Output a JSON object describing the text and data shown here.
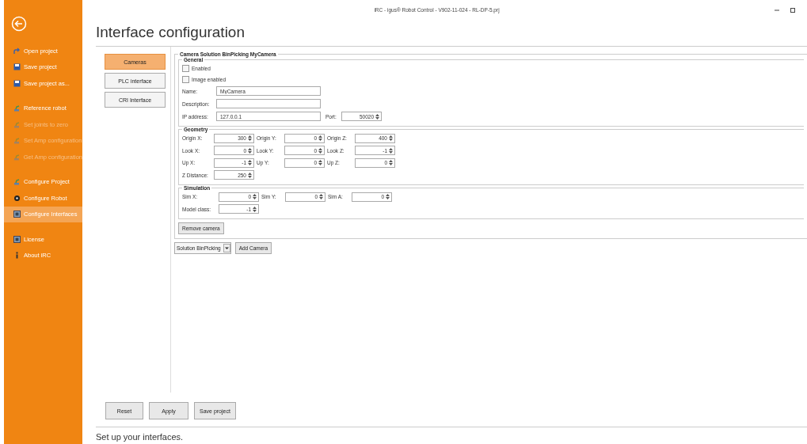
{
  "window": {
    "title": "iRC - igus® Robot Control - V902-11-024 - RL-DP-5.prj"
  },
  "sidebar": {
    "sections": [
      {
        "items": [
          {
            "label": "Open project",
            "kind": "open",
            "disabled": false,
            "selected": false
          },
          {
            "label": "Save project",
            "kind": "save",
            "disabled": false,
            "selected": false
          },
          {
            "label": "Save project as...",
            "kind": "save",
            "disabled": false,
            "selected": false
          }
        ]
      },
      {
        "items": [
          {
            "label": "Reference robot",
            "kind": "robot",
            "disabled": false,
            "selected": false
          },
          {
            "label": "Set joints to zero",
            "kind": "robot",
            "disabled": true,
            "selected": false
          },
          {
            "label": "Set Amp configuration",
            "kind": "robot",
            "disabled": true,
            "selected": false
          },
          {
            "label": "Get Amp configuration",
            "kind": "robot",
            "disabled": true,
            "selected": false
          }
        ]
      },
      {
        "items": [
          {
            "label": "Configure Project",
            "kind": "robot",
            "disabled": false,
            "selected": false
          },
          {
            "label": "Configure Robot",
            "kind": "gear",
            "disabled": false,
            "selected": false
          },
          {
            "label": "Configure Interfaces",
            "kind": "box",
            "disabled": false,
            "selected": true
          }
        ]
      },
      {
        "items": [
          {
            "label": "License",
            "kind": "box",
            "disabled": false,
            "selected": false
          },
          {
            "label": "About iRC",
            "kind": "info",
            "disabled": false,
            "selected": false
          }
        ]
      }
    ]
  },
  "page": {
    "title": "Interface configuration",
    "status": "Set up your interfaces."
  },
  "tabs": [
    {
      "label": "Cameras",
      "selected": true
    },
    {
      "label": "PLC interface",
      "selected": false
    },
    {
      "label": "CRI Interface",
      "selected": false
    }
  ],
  "camera": {
    "title": "Camera Solution BinPicking MyCamera",
    "general": {
      "title": "General",
      "checkboxes": [
        {
          "label": "Enabled",
          "checked": false
        },
        {
          "label": "Image enabled",
          "checked": false
        }
      ],
      "name": {
        "label": "Name:",
        "value": "MyCamera"
      },
      "description": {
        "label": "Description:"
      },
      "ip": {
        "label": "IP address:",
        "value": "127.0.0.1"
      },
      "port": {
        "label": "Port:",
        "value": "50020"
      }
    },
    "geometry": {
      "title": "Geometry",
      "rows": [
        [
          {
            "label": "Origin X:",
            "value": "300"
          },
          {
            "label": "Origin Y:",
            "value": "0"
          },
          {
            "label": "Origin Z:",
            "value": "400"
          }
        ],
        [
          {
            "label": "Look X:",
            "value": "0"
          },
          {
            "label": "Look Y:",
            "value": "0"
          },
          {
            "label": "Look Z:",
            "value": "-1"
          }
        ],
        [
          {
            "label": "Up X:",
            "value": "-1"
          },
          {
            "label": "Up Y:",
            "value": "0"
          },
          {
            "label": "Up Z:",
            "value": "0"
          }
        ],
        [
          {
            "label": "Z Distance:",
            "value": "250"
          }
        ]
      ]
    },
    "simulation": {
      "title": "Simulation",
      "rows": [
        [
          {
            "label": "Sim X:",
            "value": "0"
          },
          {
            "label": "Sim Y:",
            "value": "0"
          },
          {
            "label": "Sim A:",
            "value": "0"
          }
        ],
        [
          {
            "label": "Model class:",
            "value": "-1"
          }
        ]
      ]
    },
    "remove_button": "Remove camera"
  },
  "solution_select": {
    "value": "Solution BinPicking"
  },
  "add_button": "Add Camera",
  "buttons": [
    "Reset",
    "Apply",
    "Save project"
  ]
}
